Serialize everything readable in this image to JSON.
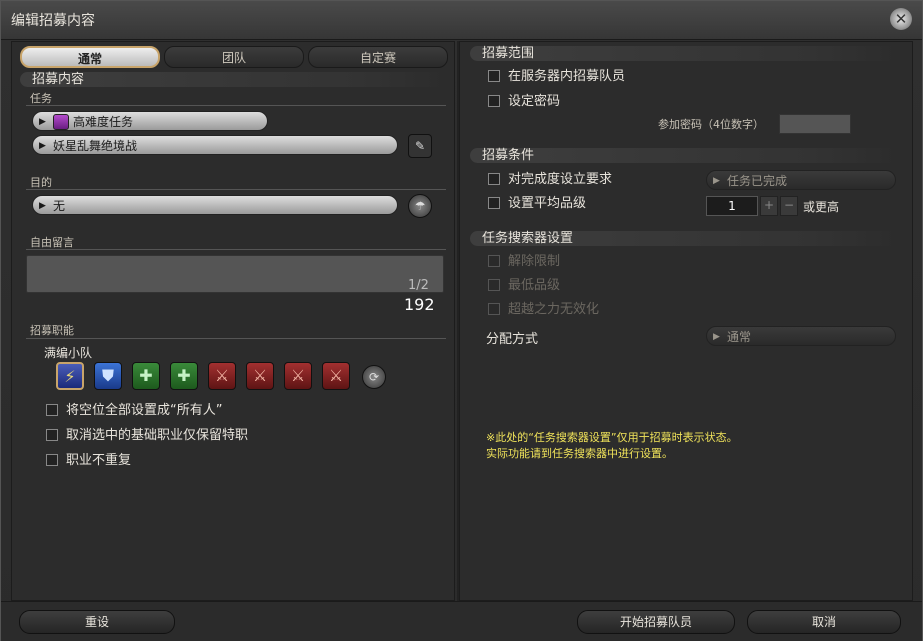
{
  "window": {
    "title": "编辑招募内容"
  },
  "tabs": [
    "通常",
    "团队",
    "自定赛"
  ],
  "left": {
    "header": "招募内容",
    "duty_label": "任务",
    "duty_category": "高难度任务",
    "duty_name": "妖星乱舞绝境战",
    "purpose_label": "目的",
    "purpose_value": "无",
    "comment_label": "自由留言",
    "comment_value": "",
    "counter_small": "1/2",
    "counter_big": "192",
    "jobs_label": "招募职能",
    "party_label": "满编小队",
    "checkboxes": [
      "将空位全部设置成“所有人”",
      "取消选中的基础职业仅保留特职",
      "职业不重复"
    ]
  },
  "right": {
    "range_header": "招募范围",
    "range_opt1": "在服务器内招募队员",
    "range_opt2": "设定密码",
    "password_label": "参加密码（4位数字）",
    "cond_header": "招募条件",
    "cond_opt1": "对完成度设立要求",
    "cond_opt1_value": "任务已完成",
    "cond_opt2": "设置平均品级",
    "item_level": "1",
    "item_level_suffix": "或更高",
    "finder_header": "任务搜索器设置",
    "finder_opts": [
      "解除限制",
      "最低品级",
      "超越之力无效化"
    ],
    "assign_label": "分配方式",
    "assign_value": "通常",
    "note_line1": "※此处的“任务搜索器设置”仅用于招募时表示状态。",
    "note_line2": "实际功能请到任务搜索器中进行设置。"
  },
  "footer": {
    "reset": "重设",
    "start": "开始招募队员",
    "cancel": "取消"
  }
}
